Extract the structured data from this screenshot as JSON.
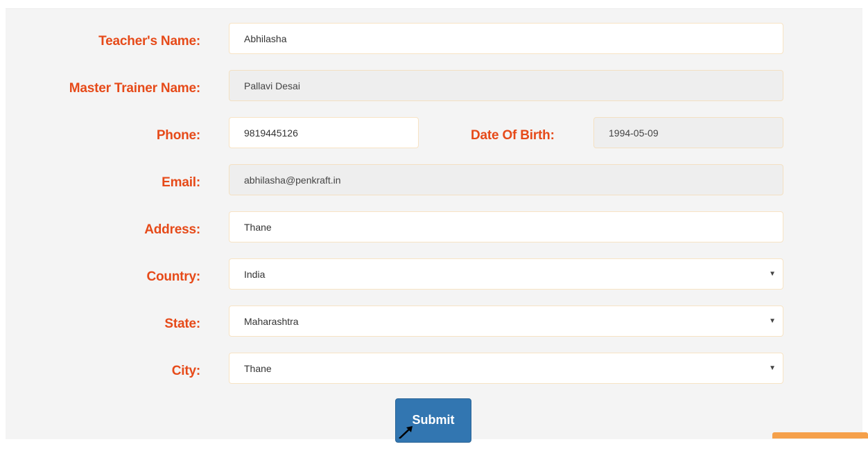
{
  "form": {
    "teacher_name": {
      "label": "Teacher's Name:",
      "value": "Abhilasha"
    },
    "master_trainer": {
      "label": "Master Trainer Name:",
      "value": "Pallavi Desai"
    },
    "phone": {
      "label": "Phone:",
      "value": "9819445126"
    },
    "dob": {
      "label": "Date Of Birth:",
      "value": "1994-05-09"
    },
    "email": {
      "label": "Email:",
      "value": "abhilasha@penkraft.in"
    },
    "address": {
      "label": "Address:",
      "value": "Thane"
    },
    "country": {
      "label": "Country:",
      "value": "India"
    },
    "state": {
      "label": "State:",
      "value": "Maharashtra"
    },
    "city": {
      "label": "City:",
      "value": "Thane"
    },
    "submit_label": "Submit"
  },
  "colors": {
    "label": "#e64a19",
    "submit": "#3276b1",
    "background": "#f4f4f4",
    "readonly_field": "#eeeeee",
    "corner_tab": "#f5a04a"
  },
  "icons": {
    "select_caret": "caret-down-icon",
    "pointer": "mouse-cursor-icon"
  }
}
